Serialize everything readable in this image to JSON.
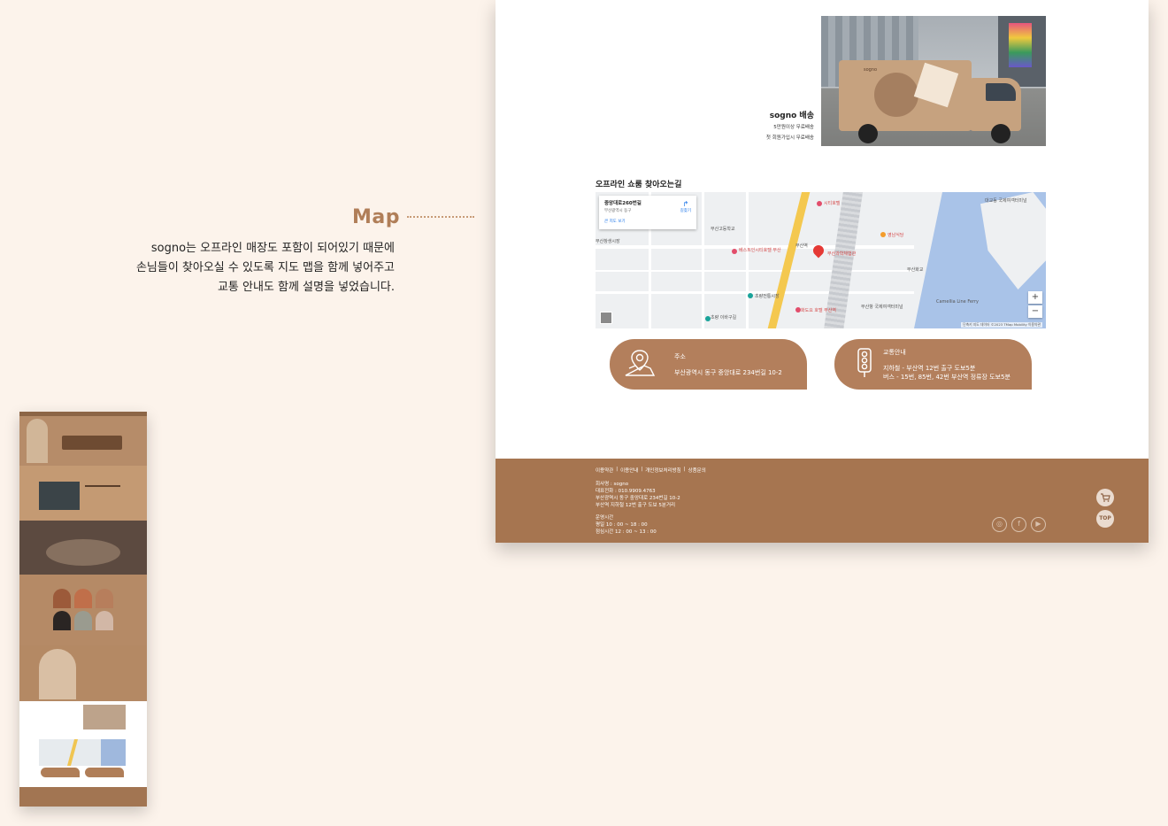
{
  "annotation": {
    "title": "Map",
    "lines": [
      "sogno는 오프라인 매장도 포함이 되어있기 때문에",
      "손님들이 찾아오실 수 있도록 지도 맵을 함께 넣어주고",
      "교통 안내도 함께 설명을 넣었습니다."
    ]
  },
  "delivery": {
    "title": "sogno 배송",
    "lines": [
      "5만원이상 무료배송",
      "첫 회원가입시 무료배송"
    ],
    "truck_brand": "sogno"
  },
  "map_section": {
    "heading": "오프라인 쇼룸 찾아오는길",
    "card_title": "중앙대로260번길",
    "card_subtitle": "부산광역시 동구",
    "card_link": "큰 지도 보기",
    "directions": "길찾기",
    "labels": [
      "시티호텔",
      "부산과학체험관",
      "베스트인시티호텔 부산",
      "부산역",
      "초량전통시장",
      "부산항 국제여객터미널",
      "대교동 국제여객터미널",
      "Camellia Line Ferry",
      "화도요 호텔 부산역",
      "부산화교",
      "초량 이바구길",
      "부산고등학교",
      "부산창생시장",
      "영남식당"
    ],
    "zoom_in": "+",
    "zoom_out": "−",
    "footer": "단축키  지도 데이터 ©2023 TMap Mobility  이용약관"
  },
  "info": {
    "address_label": "주소",
    "address_value": "부산광역시 동구 중앙대로 234번길 10-2",
    "traffic_label": "교통안내",
    "traffic_lines": [
      "지하철 - 부산역 12번 출구 도보5분",
      "버스 - 15번, 85번, 42번 부산역 정류장 도보5분"
    ]
  },
  "footer": {
    "links": [
      "이용약관",
      "|",
      "이용안내",
      "|",
      "개인정보처리방침",
      "|",
      "상품문의"
    ],
    "company_lines": [
      "회사명 : sogno",
      "대표전화 : 010.9909.4763",
      "부산광역시 동구 중앙대로 234번길 10-2",
      "부산역 지하철 12번 출구 도보 5분거리"
    ],
    "hours_lines": [
      "운영시간",
      "평일 10 : 00 ~ 18 : 00",
      "점심시간 12 : 00 ~ 13 : 00"
    ],
    "cart_icon": "cart-icon",
    "top_label": "TOP",
    "social_icons": [
      "instagram-icon",
      "facebook-icon",
      "youtube-icon"
    ]
  },
  "colors": {
    "accent": "#b07e58",
    "brown": "#a67550",
    "pill": "#b37f5c",
    "background": "#fcf3eb"
  }
}
